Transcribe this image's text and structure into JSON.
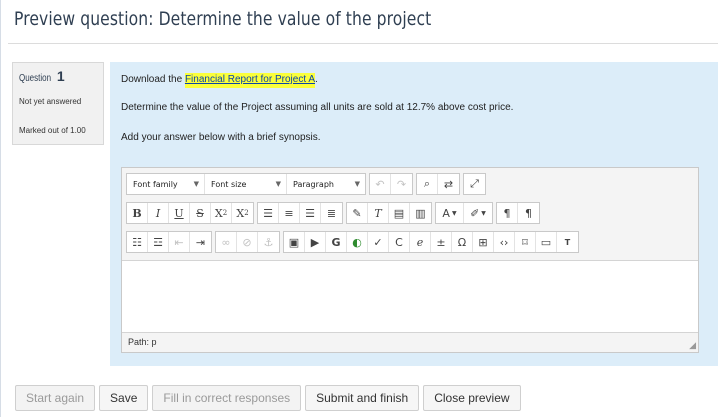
{
  "page": {
    "title": "Preview question: Determine the value of the project"
  },
  "question_info": {
    "label": "Question",
    "number": "1",
    "state": "Not yet answered",
    "grade": "Marked out of 1.00"
  },
  "question": {
    "line1_prefix": "Download the ",
    "line1_link": "Financial Report for Project A",
    "line1_suffix": ".",
    "line2": "Determine the value of the Project assuming all units are sold at 12.7% above cost price.",
    "line3": "Add your answer below with a brief synopsis."
  },
  "editor": {
    "font_family": "Font family",
    "font_size": "Font size",
    "format": "Paragraph",
    "path": "Path: p",
    "colors": {
      "content_bg": "#dcedf9",
      "link_highlight": "#fbff3b",
      "link": "#0b45a8"
    }
  },
  "footer": {
    "start_again": "Start again",
    "save": "Save",
    "fill_correct": "Fill in correct responses",
    "submit_finish": "Submit and finish",
    "close_preview": "Close preview"
  }
}
